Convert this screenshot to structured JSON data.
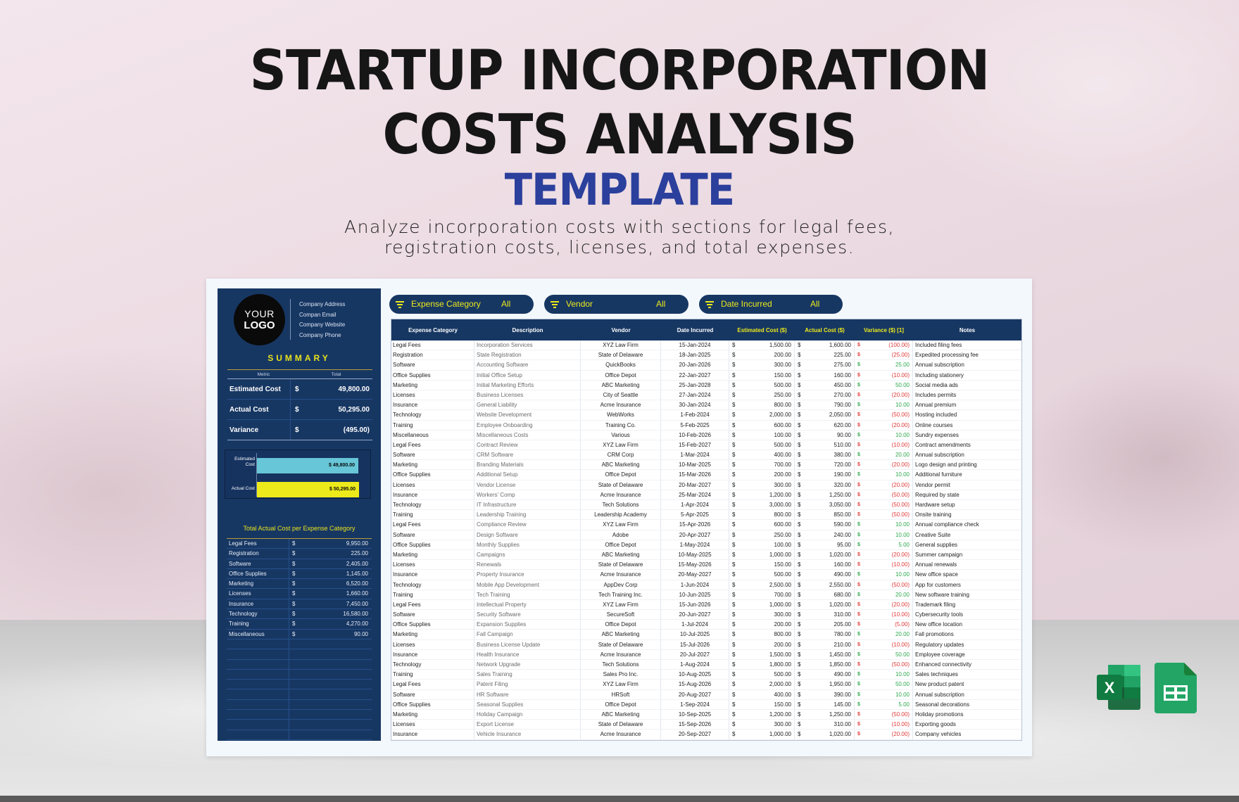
{
  "header": {
    "title_line1": "STARTUP INCORPORATION",
    "title_line2": "COSTS ANALYSIS",
    "title_line3": "TEMPLATE",
    "subtitle_line1": "Analyze incorporation costs with sections for legal fees,",
    "subtitle_line2": "registration costs, licenses, and total expenses."
  },
  "colors": {
    "panel_navy": "#173763",
    "accent_yellow": "#ecea1a",
    "title_blue": "#2b3f9c",
    "bar_estimated": "#67c6d7",
    "bar_actual": "#ecea1a",
    "negative": "#e03a3a",
    "positive": "#2fa84f"
  },
  "company": {
    "logo_line1": "YOUR",
    "logo_line2": "LOGO",
    "address": "Company Address",
    "email": "Compan Email",
    "website": "Company Website",
    "phone": "Company Phone"
  },
  "summary": {
    "title": "SUMMARY",
    "col_metric": "Metric",
    "col_total": "Total",
    "rows": [
      {
        "metric": "Estimated Cost",
        "currency": "$",
        "value": "49,800.00"
      },
      {
        "metric": "Actual Cost",
        "currency": "$",
        "value": "50,295.00"
      },
      {
        "metric": "Variance",
        "currency": "$",
        "value": "(495.00)"
      }
    ]
  },
  "chart_data": {
    "type": "bar",
    "orientation": "horizontal",
    "categories": [
      "Estimated Cost",
      "Actual Cost"
    ],
    "values": [
      49800,
      50295
    ],
    "data_labels": [
      "$ 49,800.00",
      "$ 50,295.00"
    ],
    "title": "",
    "xlabel": "",
    "ylabel": "",
    "xlim": [
      0,
      52000
    ],
    "grid": false,
    "legend": "none"
  },
  "category_totals": {
    "title": "Total Actual Cost per Expense Category",
    "rows": [
      {
        "category": "Legal Fees",
        "currency": "$",
        "value": "9,950.00"
      },
      {
        "category": "Registration",
        "currency": "$",
        "value": "225.00"
      },
      {
        "category": "Software",
        "currency": "$",
        "value": "2,405.00"
      },
      {
        "category": "Office Supplies",
        "currency": "$",
        "value": "1,145.00"
      },
      {
        "category": "Marketing",
        "currency": "$",
        "value": "6,520.00"
      },
      {
        "category": "Licenses",
        "currency": "$",
        "value": "1,660.00"
      },
      {
        "category": "Insurance",
        "currency": "$",
        "value": "7,450.00"
      },
      {
        "category": "Technology",
        "currency": "$",
        "value": "16,580.00"
      },
      {
        "category": "Training",
        "currency": "$",
        "value": "4,270.00"
      },
      {
        "category": "Miscellaneous",
        "currency": "$",
        "value": "90.00"
      },
      {
        "category": "",
        "currency": "",
        "value": ""
      },
      {
        "category": "",
        "currency": "",
        "value": ""
      },
      {
        "category": "",
        "currency": "",
        "value": ""
      },
      {
        "category": "",
        "currency": "",
        "value": ""
      },
      {
        "category": "",
        "currency": "",
        "value": ""
      },
      {
        "category": "",
        "currency": "",
        "value": ""
      },
      {
        "category": "",
        "currency": "",
        "value": ""
      },
      {
        "category": "",
        "currency": "",
        "value": ""
      },
      {
        "category": "",
        "currency": "",
        "value": ""
      },
      {
        "category": "",
        "currency": "",
        "value": ""
      }
    ]
  },
  "filters": [
    {
      "label": "Expense Category",
      "value": "All",
      "icon": "filter-icon"
    },
    {
      "label": "Vendor",
      "value": "All",
      "icon": "filter-icon"
    },
    {
      "label": "Date Incurred",
      "value": "All",
      "icon": "filter-icon"
    }
  ],
  "table": {
    "columns": [
      "Expense Category",
      "Description",
      "Vendor",
      "Date Incurred",
      "Estimated Cost ($)",
      "Actual Cost ($)",
      "Variance ($) [1]",
      "Notes"
    ],
    "rows": [
      [
        "Legal Fees",
        "Incorporation Services",
        "XYZ Law Firm",
        "15-Jan-2024",
        "1,500.00",
        "1,600.00",
        "(100.00)",
        "Included filing fees"
      ],
      [
        "Registration",
        "State Registration",
        "State of Delaware",
        "18-Jan-2025",
        "200.00",
        "225.00",
        "(25.00)",
        "Expedited processing fee"
      ],
      [
        "Software",
        "Accounting Software",
        "QuickBooks",
        "20-Jan-2026",
        "300.00",
        "275.00",
        "25.00",
        "Annual subscription"
      ],
      [
        "Office Supplies",
        "Initial Office Setup",
        "Office Depot",
        "22-Jan-2027",
        "150.00",
        "160.00",
        "(10.00)",
        "Including stationery"
      ],
      [
        "Marketing",
        "Initial Marketing Efforts",
        "ABC Marketing",
        "25-Jan-2028",
        "500.00",
        "450.00",
        "50.00",
        "Social media ads"
      ],
      [
        "Licenses",
        "Business Licenses",
        "City of Seattle",
        "27-Jan-2024",
        "250.00",
        "270.00",
        "(20.00)",
        "Includes permits"
      ],
      [
        "Insurance",
        "General Liability",
        "Acme Insurance",
        "30-Jan-2024",
        "800.00",
        "790.00",
        "10.00",
        "Annual premium"
      ],
      [
        "Technology",
        "Website Development",
        "WebWorks",
        "1-Feb-2024",
        "2,000.00",
        "2,050.00",
        "(50.00)",
        "Hosting included"
      ],
      [
        "Training",
        "Employee Onboarding",
        "Training Co.",
        "5-Feb-2025",
        "600.00",
        "620.00",
        "(20.00)",
        "Online courses"
      ],
      [
        "Miscellaneous",
        "Miscellaneous Costs",
        "Various",
        "10-Feb-2026",
        "100.00",
        "90.00",
        "10.00",
        "Sundry expenses"
      ],
      [
        "Legal Fees",
        "Contract Review",
        "XYZ Law Firm",
        "15-Feb-2027",
        "500.00",
        "510.00",
        "(10.00)",
        "Contract amendments"
      ],
      [
        "Software",
        "CRM Software",
        "CRM Corp",
        "1-Mar-2024",
        "400.00",
        "380.00",
        "20.00",
        "Annual subscription"
      ],
      [
        "Marketing",
        "Branding Materials",
        "ABC Marketing",
        "10-Mar-2025",
        "700.00",
        "720.00",
        "(20.00)",
        "Logo design and printing"
      ],
      [
        "Office Supplies",
        "Additional Setup",
        "Office Depot",
        "15-Mar-2026",
        "200.00",
        "190.00",
        "10.00",
        "Additional furniture"
      ],
      [
        "Licenses",
        "Vendor License",
        "State of Delaware",
        "20-Mar-2027",
        "300.00",
        "320.00",
        "(20.00)",
        "Vendor permit"
      ],
      [
        "Insurance",
        "Workers' Comp",
        "Acme Insurance",
        "25-Mar-2024",
        "1,200.00",
        "1,250.00",
        "(50.00)",
        "Required by state"
      ],
      [
        "Technology",
        "IT Infrastructure",
        "Tech Solutions",
        "1-Apr-2024",
        "3,000.00",
        "3,050.00",
        "(50.00)",
        "Hardware setup"
      ],
      [
        "Training",
        "Leadership Training",
        "Leadership Academy",
        "5-Apr-2025",
        "800.00",
        "850.00",
        "(50.00)",
        "Onsite training"
      ],
      [
        "Legal Fees",
        "Compliance Review",
        "XYZ Law Firm",
        "15-Apr-2026",
        "600.00",
        "590.00",
        "10.00",
        "Annual compliance check"
      ],
      [
        "Software",
        "Design Software",
        "Adobe",
        "20-Apr-2027",
        "250.00",
        "240.00",
        "10.00",
        "Creative Suite"
      ],
      [
        "Office Supplies",
        "Monthly Supplies",
        "Office Depot",
        "1-May-2024",
        "100.00",
        "95.00",
        "5.00",
        "General supplies"
      ],
      [
        "Marketing",
        "Campaigns",
        "ABC Marketing",
        "10-May-2025",
        "1,000.00",
        "1,020.00",
        "(20.00)",
        "Summer campaign"
      ],
      [
        "Licenses",
        "Renewals",
        "State of Delaware",
        "15-May-2026",
        "150.00",
        "160.00",
        "(10.00)",
        "Annual renewals"
      ],
      [
        "Insurance",
        "Property Insurance",
        "Acme Insurance",
        "20-May-2027",
        "500.00",
        "490.00",
        "10.00",
        "New office space"
      ],
      [
        "Technology",
        "Mobile App Development",
        "AppDev Corp",
        "1-Jun-2024",
        "2,500.00",
        "2,550.00",
        "(50.00)",
        "App for customers"
      ],
      [
        "Training",
        "Tech Training",
        "Tech Training Inc.",
        "10-Jun-2025",
        "700.00",
        "680.00",
        "20.00",
        "New software training"
      ],
      [
        "Legal Fees",
        "Intellectual Property",
        "XYZ Law Firm",
        "15-Jun-2026",
        "1,000.00",
        "1,020.00",
        "(20.00)",
        "Trademark filing"
      ],
      [
        "Software",
        "Security Software",
        "SecureSoft",
        "20-Jun-2027",
        "300.00",
        "310.00",
        "(10.00)",
        "Cybersecurity tools"
      ],
      [
        "Office Supplies",
        "Expansion Supplies",
        "Office Depot",
        "1-Jul-2024",
        "200.00",
        "205.00",
        "(5.00)",
        "New office location"
      ],
      [
        "Marketing",
        "Fall Campaign",
        "ABC Marketing",
        "10-Jul-2025",
        "800.00",
        "780.00",
        "20.00",
        "Fall promotions"
      ],
      [
        "Licenses",
        "Business License Update",
        "State of Delaware",
        "15-Jul-2026",
        "200.00",
        "210.00",
        "(10.00)",
        "Regulatory updates"
      ],
      [
        "Insurance",
        "Health Insurance",
        "Acme Insurance",
        "20-Jul-2027",
        "1,500.00",
        "1,450.00",
        "50.00",
        "Employee coverage"
      ],
      [
        "Technology",
        "Network Upgrade",
        "Tech Solutions",
        "1-Aug-2024",
        "1,800.00",
        "1,850.00",
        "(50.00)",
        "Enhanced connectivity"
      ],
      [
        "Training",
        "Sales Training",
        "Sales Pro Inc.",
        "10-Aug-2025",
        "500.00",
        "490.00",
        "10.00",
        "Sales techniques"
      ],
      [
        "Legal Fees",
        "Patent Filing",
        "XYZ Law Firm",
        "15-Aug-2026",
        "2,000.00",
        "1,950.00",
        "50.00",
        "New product patent"
      ],
      [
        "Software",
        "HR Software",
        "HRSoft",
        "20-Aug-2027",
        "400.00",
        "390.00",
        "10.00",
        "Annual subscription"
      ],
      [
        "Office Supplies",
        "Seasonal Supplies",
        "Office Depot",
        "1-Sep-2024",
        "150.00",
        "145.00",
        "5.00",
        "Seasonal decorations"
      ],
      [
        "Marketing",
        "Holiday Campaign",
        "ABC Marketing",
        "10-Sep-2025",
        "1,200.00",
        "1,250.00",
        "(50.00)",
        "Holiday promotions"
      ],
      [
        "Licenses",
        "Export License",
        "State of Delaware",
        "15-Sep-2026",
        "300.00",
        "310.00",
        "(10.00)",
        "Exporting goods"
      ],
      [
        "Insurance",
        "Vehicle Insurance",
        "Acme Insurance",
        "20-Sep-2027",
        "1,000.00",
        "1,020.00",
        "(20.00)",
        "Company vehicles"
      ]
    ]
  },
  "app_icons": [
    "excel-icon",
    "google-sheets-icon"
  ]
}
